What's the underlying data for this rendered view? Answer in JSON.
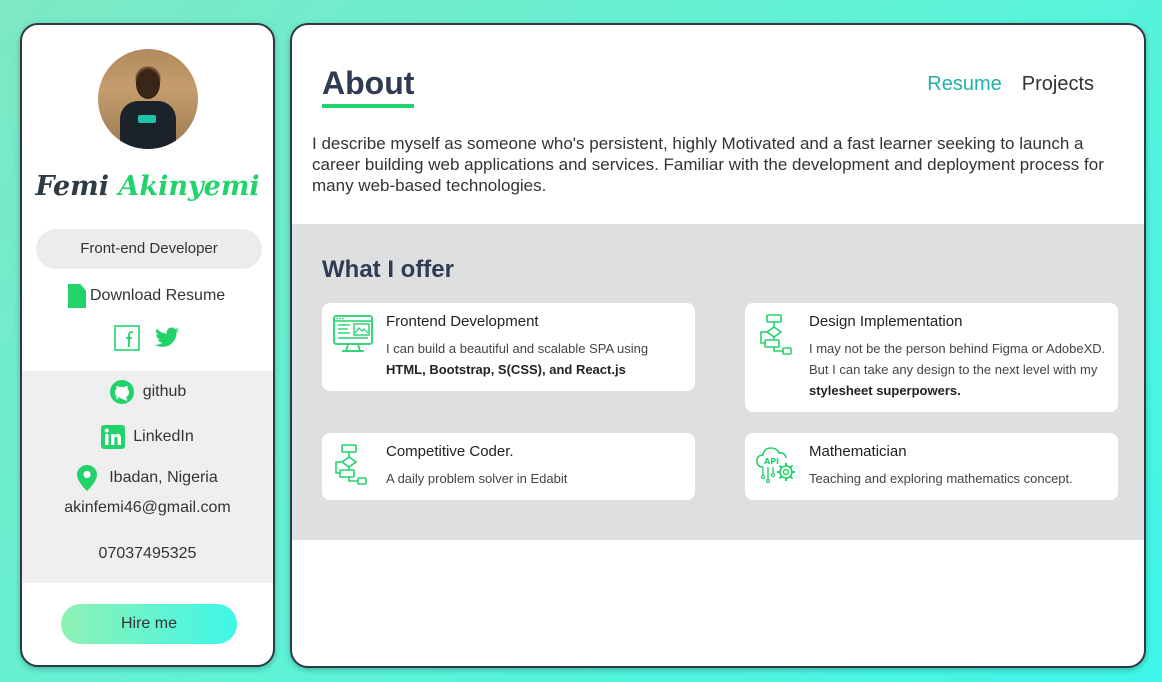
{
  "sidebar": {
    "first_name": "Femi",
    "last_name": "Akinyemi",
    "role": "Front-end Developer",
    "download_label": "Download Resume",
    "github_label": "github",
    "linkedin_label": "LinkedIn",
    "location": "Ibadan, Nigeria",
    "email": "akinfemi46@gmail.com",
    "phone": "07037495325",
    "hire_label": "Hire me"
  },
  "nav": {
    "resume": "Resume",
    "projects": "Projects"
  },
  "about": {
    "title": "About",
    "intro": "I describe myself as someone who's persistent, highly Motivated and a fast learner seeking to launch a career building web applications and services. Familiar with the development and deployment process for many web-based technologies."
  },
  "offer": {
    "title": "What I offer",
    "cards": [
      {
        "title": "Frontend Development",
        "desc": "I can build a beautiful and scalable SPA using",
        "desc_bold": "HTML, Bootstrap, S(CSS), and React.js",
        "icon": "monitor-code-icon"
      },
      {
        "title": "Design Implementation",
        "desc": "I may not be the person behind Figma or AdobeXD. But I can take any design to the next level with my",
        "desc_bold": "stylesheet superpowers.",
        "icon": "flowchart-icon"
      },
      {
        "title": "Competitive Coder.",
        "desc": "A daily problem solver in Edabit",
        "icon": "flowchart-icon"
      },
      {
        "title": "Mathematician",
        "desc": "Teaching and exploring mathematics concept.",
        "icon": "api-gear-icon"
      }
    ]
  },
  "colors": {
    "accent_green": "#22d36b",
    "accent_teal": "#1eb3a7",
    "dark_text": "#2f3b52"
  }
}
